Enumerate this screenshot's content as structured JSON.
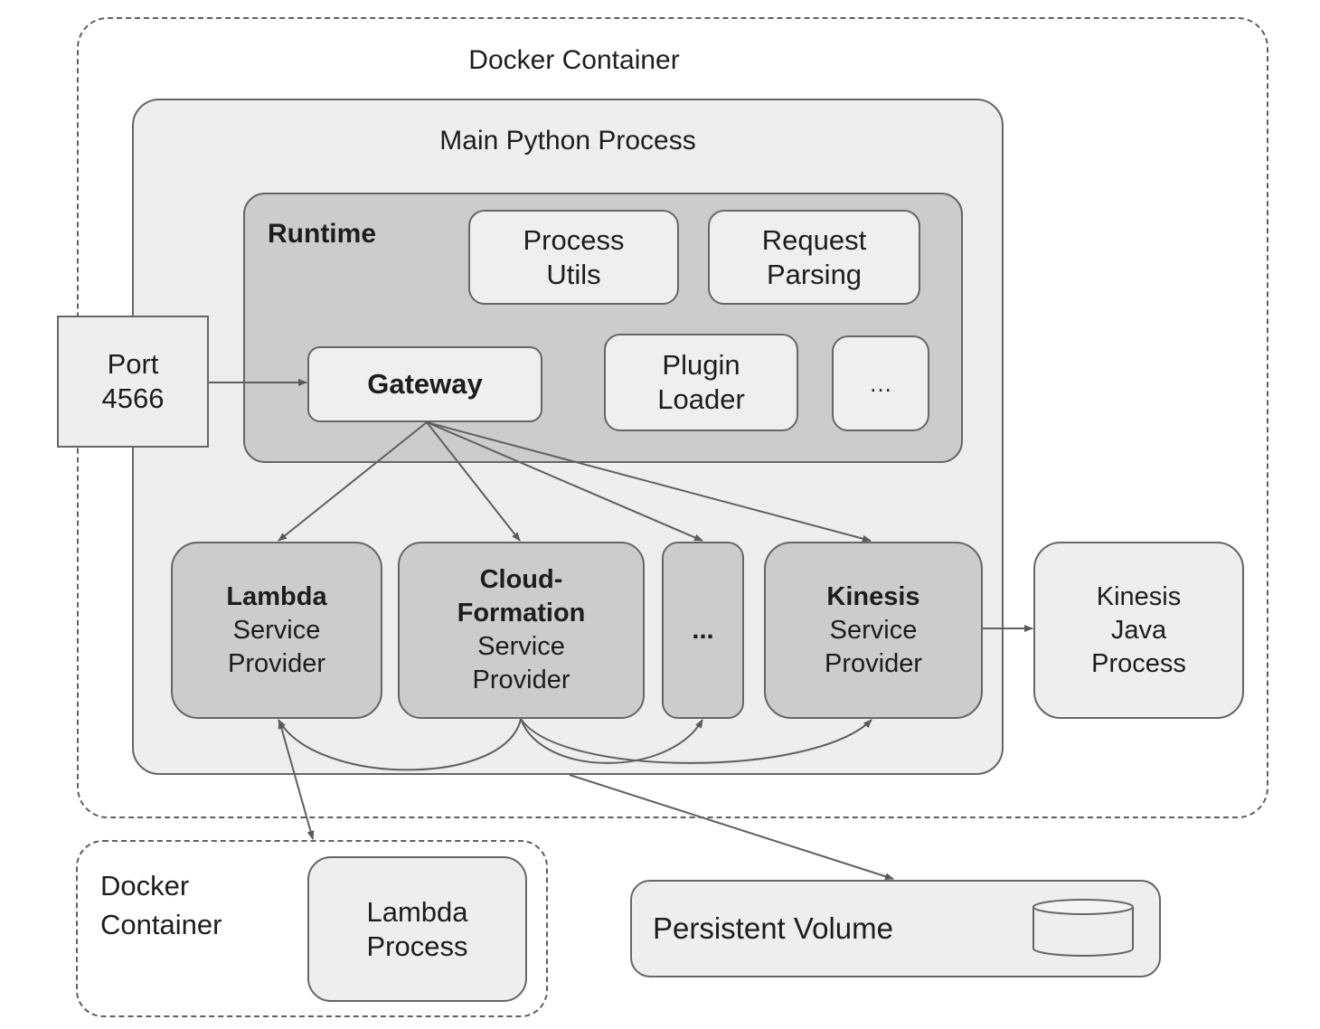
{
  "diagram": {
    "outer_container": {
      "label": "Docker Container"
    },
    "main_process": {
      "label": "Main Python Process"
    },
    "runtime": {
      "label": "Runtime",
      "components": [
        {
          "id": "process-utils",
          "lines": [
            "Process",
            "Utils"
          ]
        },
        {
          "id": "request-parsing",
          "lines": [
            "Request",
            "Parsing"
          ]
        },
        {
          "id": "gateway",
          "lines": [
            "Gateway"
          ],
          "bold": true
        },
        {
          "id": "plugin-loader",
          "lines": [
            "Plugin",
            "Loader"
          ]
        },
        {
          "id": "runtime-more",
          "lines": [
            "…"
          ]
        }
      ]
    },
    "port": {
      "lines": [
        "Port",
        "4566"
      ]
    },
    "service_providers": [
      {
        "id": "lambda",
        "title": "Lambda",
        "subtitle": [
          "Service",
          "Provider"
        ]
      },
      {
        "id": "cloudformation",
        "title_lines": [
          "Cloud-",
          "Formation"
        ],
        "subtitle": [
          "Service",
          "Provider"
        ]
      },
      {
        "id": "more",
        "title": "..."
      },
      {
        "id": "kinesis",
        "title": "Kinesis",
        "subtitle": [
          "Service",
          "Provider"
        ]
      }
    ],
    "kinesis_java": {
      "lines": [
        "Kinesis",
        "Java",
        "Process"
      ]
    },
    "lambda_container": {
      "label_lines": [
        "Docker",
        "Container"
      ],
      "process_lines": [
        "Lambda",
        "Process"
      ]
    },
    "persistent_volume": {
      "label": "Persistent Volume",
      "icon": "database-cylinder-icon"
    },
    "edges": [
      {
        "from": "port-4566",
        "to": "gateway"
      },
      {
        "from": "gateway",
        "to": "lambda-service-provider"
      },
      {
        "from": "gateway",
        "to": "cloudformation-service-provider"
      },
      {
        "from": "gateway",
        "to": "more-service-provider"
      },
      {
        "from": "gateway",
        "to": "kinesis-service-provider"
      },
      {
        "from": "cloudformation-service-provider",
        "to": "lambda-service-provider"
      },
      {
        "from": "cloudformation-service-provider",
        "to": "more-service-provider"
      },
      {
        "from": "cloudformation-service-provider",
        "to": "kinesis-service-provider"
      },
      {
        "from": "kinesis-service-provider",
        "to": "kinesis-java-process"
      },
      {
        "from": "lambda-service-provider",
        "to": "lambda-docker-container",
        "bidirectional": true
      },
      {
        "from": "main-python-process",
        "to": "persistent-volume"
      }
    ],
    "colors": {
      "line": "#666666",
      "container_fill": "#eeeeee",
      "runtime_fill": "#cccccc",
      "provider_fill": "#cccccc",
      "component_fill": "#efefef"
    }
  }
}
